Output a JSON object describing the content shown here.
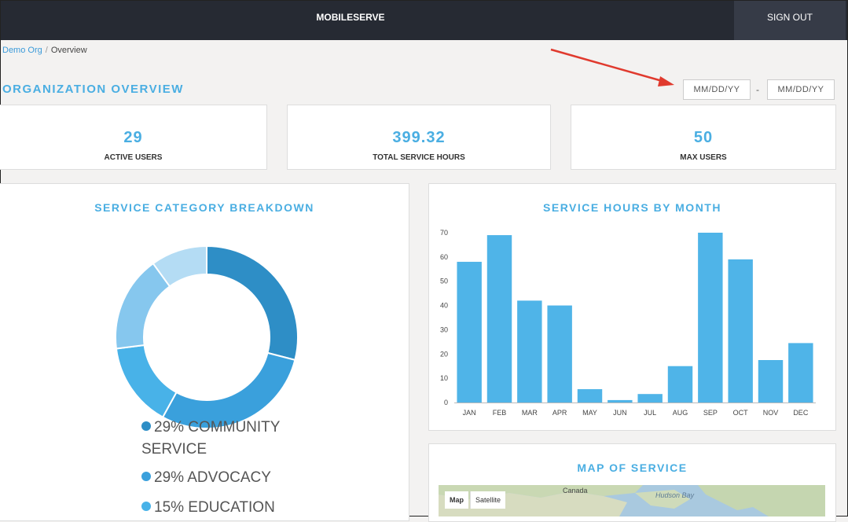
{
  "header": {
    "brand": "MOBILESERVE",
    "signout_label": "SIGN OUT"
  },
  "breadcrumb": {
    "org": "Demo Org",
    "separator": "/",
    "current": "Overview"
  },
  "page_title": "ORGANIZATION OVERVIEW",
  "date_range": {
    "start_placeholder": "MM/DD/YY",
    "separator": "-",
    "end_placeholder": "MM/DD/YY"
  },
  "stats": [
    {
      "value": "29",
      "label": "ACTIVE USERS"
    },
    {
      "value": "399.32",
      "label": "TOTAL SERVICE HOURS"
    },
    {
      "value": "50",
      "label": "MAX USERS"
    }
  ],
  "category_panel": {
    "title": "SERVICE CATEGORY BREAKDOWN",
    "legend": [
      {
        "text": "29% COMMUNITY SERVICE",
        "color": "#2e8ec6"
      },
      {
        "text": "29% ADVOCACY",
        "color": "#3aa0dc"
      },
      {
        "text": "15% EDUCATION",
        "color": "#48b2e8"
      }
    ]
  },
  "hours_panel": {
    "title": "SERVICE HOURS BY MONTH"
  },
  "map_panel": {
    "title": "MAP OF SERVICE",
    "map_button": "Map",
    "satellite_button": "Satellite",
    "labels": {
      "canada": "Canada",
      "hudson_bay": "Hudson Bay"
    }
  },
  "chart_data": [
    {
      "type": "pie",
      "title": "SERVICE CATEGORY BREAKDOWN",
      "slices": [
        {
          "name": "COMMUNITY SERVICE",
          "value": 29,
          "color": "#2e8ec6"
        },
        {
          "name": "ADVOCACY",
          "value": 29,
          "color": "#3aa0dc"
        },
        {
          "name": "EDUCATION",
          "value": 15,
          "color": "#48b2e8"
        },
        {
          "value": 17,
          "color": "#86c7ee"
        },
        {
          "value": 10,
          "color": "#b4dcf4"
        }
      ]
    },
    {
      "type": "bar",
      "title": "SERVICE HOURS BY MONTH",
      "categories": [
        "JAN",
        "FEB",
        "MAR",
        "APR",
        "MAY",
        "JUN",
        "JUL",
        "AUG",
        "SEP",
        "OCT",
        "NOV",
        "DEC"
      ],
      "values": [
        58,
        69,
        42,
        40,
        5.5,
        1,
        3.5,
        15,
        70,
        59,
        17.5,
        24.5
      ],
      "ylim": [
        0,
        70
      ],
      "yticks": [
        0,
        10,
        20,
        30,
        40,
        50,
        60,
        70
      ],
      "color": "#4fb4e8",
      "grid": false
    }
  ]
}
